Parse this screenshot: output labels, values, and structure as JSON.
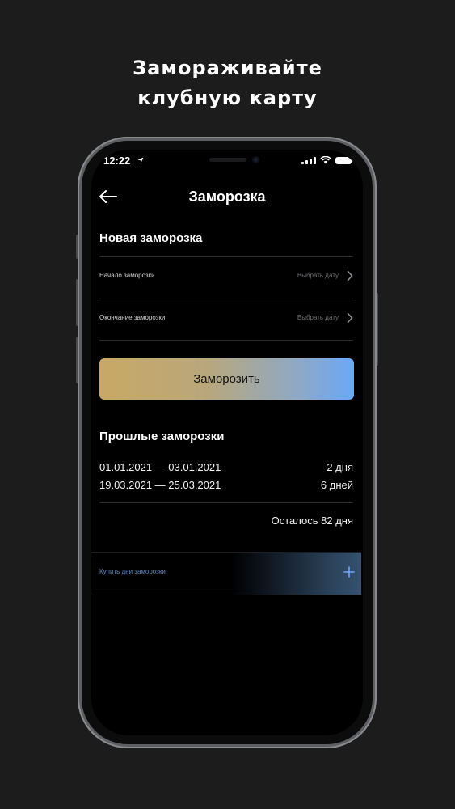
{
  "promo": {
    "line1": "Замораживайте",
    "line2": "клубную карту"
  },
  "status_bar": {
    "time": "12:22",
    "icons": [
      "location-arrow-icon",
      "signal-icon",
      "wifi-icon",
      "battery-icon"
    ]
  },
  "header": {
    "title": "Заморозка",
    "back_icon": "arrow-left-icon"
  },
  "new_freeze": {
    "title": "Новая заморозка",
    "fields": [
      {
        "label": "Начало заморозки",
        "value": "Выбрать дату"
      },
      {
        "label": "Окончание заморозки",
        "value": "Выбрать дату"
      }
    ],
    "button_label": "Заморозить"
  },
  "past_freezes": {
    "title": "Прошлые заморозки",
    "items": [
      {
        "dates": "01.01.2021 — 03.01.2021",
        "duration": "2 дня"
      },
      {
        "dates": "19.03.2021 — 25.03.2021",
        "duration": "6 дней"
      }
    ],
    "remaining": "Осталось 82 дня"
  },
  "buy": {
    "label": "Купить дни заморозки",
    "icon": "plus-icon"
  },
  "colors": {
    "background": "#1c1c1d",
    "screen": "#000000",
    "button_gradient_start": "#c9a865",
    "button_gradient_end": "#6aa8f7",
    "accent_blue": "#5b87c0"
  }
}
